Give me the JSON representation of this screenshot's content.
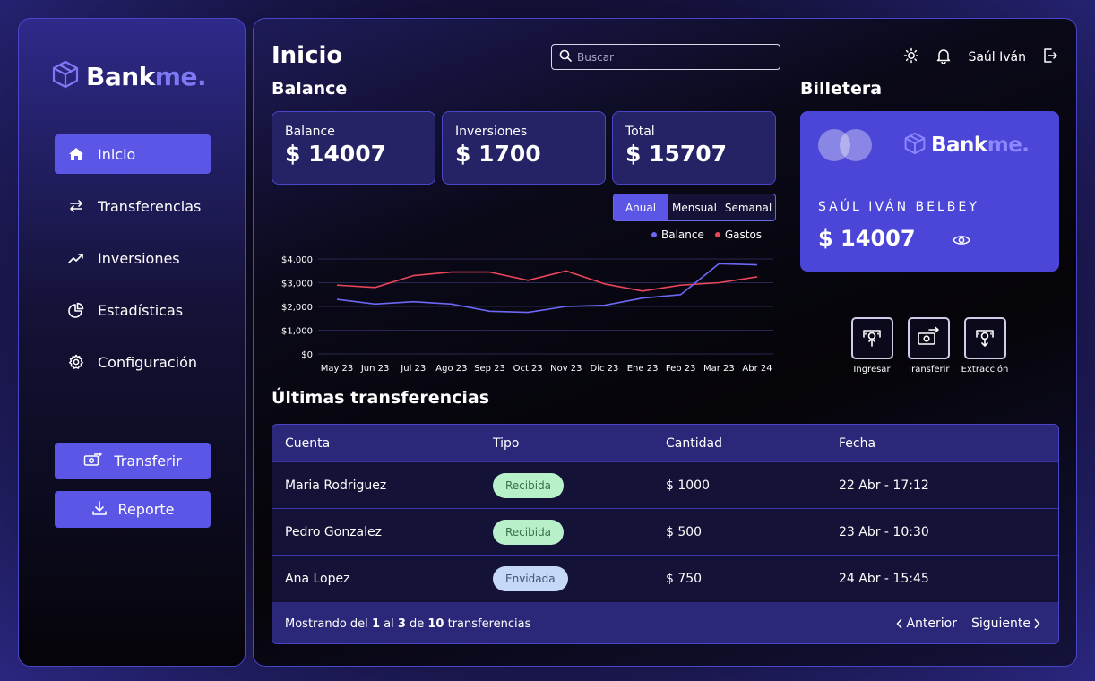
{
  "brand": {
    "name_main": "Bank",
    "name_accent": "me."
  },
  "sidebar": {
    "items": [
      {
        "label": "Inicio",
        "icon": "home-icon",
        "active": true
      },
      {
        "label": "Transferencias",
        "icon": "arrows-icon",
        "active": false
      },
      {
        "label": "Inversiones",
        "icon": "trend-up-icon",
        "active": false
      },
      {
        "label": "Estadísticas",
        "icon": "pie-chart-icon",
        "active": false
      },
      {
        "label": "Configuración",
        "icon": "gear-icon",
        "active": false
      }
    ],
    "transfer_button": "Transferir",
    "report_button": "Reporte"
  },
  "header": {
    "title": "Inicio",
    "search_placeholder": "Buscar",
    "user_name": "Saúl Iván"
  },
  "balance": {
    "title": "Balance",
    "cards": [
      {
        "label": "Balance",
        "value": "$ 14007"
      },
      {
        "label": "Inversiones",
        "value": "$ 1700"
      },
      {
        "label": "Total",
        "value": "$ 15707"
      }
    ],
    "periods": [
      "Anual",
      "Mensual",
      "Semanal"
    ],
    "active_period": "Anual"
  },
  "chart_data": {
    "type": "line",
    "x": [
      "May 23",
      "Jun 23",
      "Jul 23",
      "Ago 23",
      "Sep 23",
      "Oct 23",
      "Nov 23",
      "Dic 23",
      "Ene 23",
      "Feb 23",
      "Mar 23",
      "Abr 24"
    ],
    "series": [
      {
        "name": "Balance",
        "color": "#6c68f2",
        "values": [
          2300,
          2100,
          2200,
          2100,
          1800,
          1750,
          2000,
          2050,
          2350,
          2500,
          3800,
          3750
        ]
      },
      {
        "name": "Gastos",
        "color": "#e8455a",
        "values": [
          2900,
          2800,
          3300,
          3450,
          3450,
          3100,
          3500,
          2950,
          2650,
          2900,
          3000,
          3250
        ]
      }
    ],
    "yticks": [
      "$4,000",
      "$3,000",
      "$2,000",
      "$1,000",
      "$0"
    ],
    "ylim": [
      0,
      4000
    ],
    "grid": true,
    "legend": "top-right"
  },
  "wallet": {
    "title": "Billetera",
    "holder": "SAÚL IVÁN BELBEY",
    "amount": "$ 14007",
    "actions": [
      {
        "label": "Ingresar",
        "icon": "deposit-icon"
      },
      {
        "label": "Transferir",
        "icon": "transfer-icon"
      },
      {
        "label": "Extracción",
        "icon": "withdraw-icon"
      }
    ]
  },
  "transfers": {
    "title": "Últimas transferencias",
    "columns": [
      "Cuenta",
      "Tipo",
      "Cantidad",
      "Fecha"
    ],
    "rows": [
      {
        "account": "Maria Rodriguez",
        "type": "Recibida",
        "amount": "$ 1000",
        "date": "22 Abr - 17:12"
      },
      {
        "account": "Pedro Gonzalez",
        "type": "Recibida",
        "amount": "$ 500",
        "date": "23 Abr - 10:30"
      },
      {
        "account": "Ana Lopez",
        "type": "Envidada",
        "amount": "$ 750",
        "date": "24 Abr - 15:45"
      }
    ],
    "footer": {
      "prefix": "Mostrando del ",
      "from": "1",
      "mid1": " al ",
      "to": "3",
      "mid2": " de ",
      "total": "10",
      "suffix": " transferencias"
    },
    "prev_label": "Anterior",
    "next_label": "Siguiente"
  },
  "colors": {
    "accent": "#5b56e6",
    "gastos": "#e8455a",
    "balance": "#6c68f2",
    "received_badge": "#b7f0c9",
    "sent_badge": "#c5d8f7"
  }
}
